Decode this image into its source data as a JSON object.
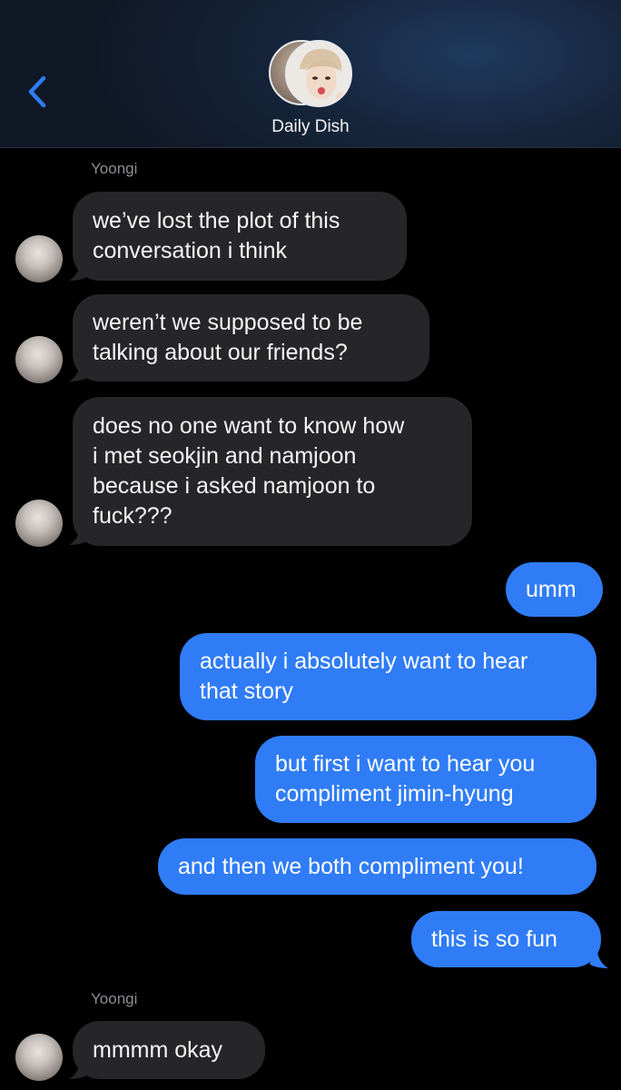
{
  "header": {
    "group_name": "Daily Dish"
  },
  "messages": [
    {
      "sender": "Yoongi"
    },
    {
      "text": "we’ve lost the plot of this\nconversation i think"
    },
    {
      "text": "weren’t we supposed to be\ntalking about our friends?"
    },
    {
      "text": "does no one want to know how\ni met seokjin and namjoon\nbecause i asked namjoon to\nfuck???"
    },
    {
      "text": "umm"
    },
    {
      "text": "actually i absolutely want to hear\nthat story"
    },
    {
      "text": "but first i want to hear you\ncompliment jimin-hyung"
    },
    {
      "text": "and then we both compliment you!"
    },
    {
      "text": "this is so fun"
    },
    {
      "sender": "Yoongi"
    },
    {
      "text": "mmmm okay"
    }
  ],
  "colors": {
    "incoming_bubble": "#262629",
    "outgoing_bubble": "#2f7cf6",
    "sender_label": "#8e8e93",
    "back_chevron": "#2f7cf6"
  },
  "icons": {
    "back": "chevron-left-icon"
  }
}
